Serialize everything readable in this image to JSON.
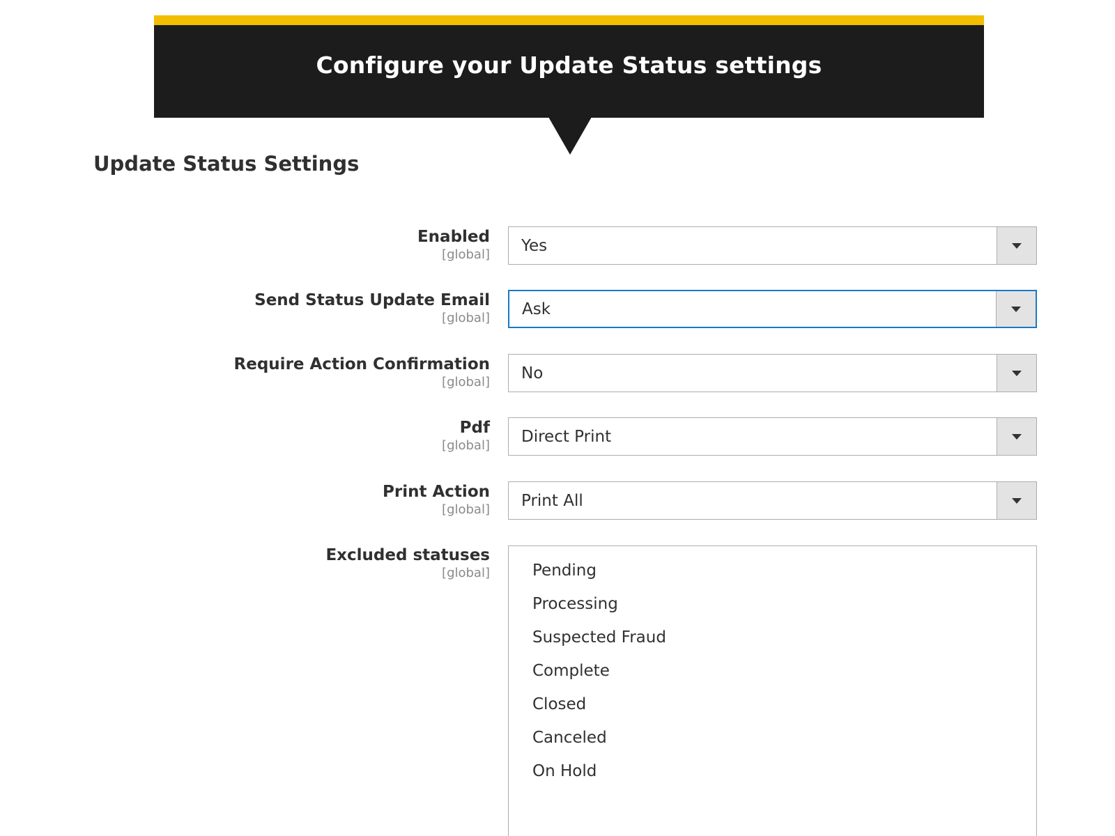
{
  "banner": {
    "title": "Configure your Update Status settings",
    "accent_color": "#f2be00",
    "background_color": "#1c1c1c"
  },
  "section": {
    "title": "Update Status Settings"
  },
  "fields": [
    {
      "label": "Enabled",
      "scope": "[global]",
      "value": "Yes",
      "focused": false
    },
    {
      "label": "Send Status Update Email",
      "scope": "[global]",
      "value": "Ask",
      "focused": true
    },
    {
      "label": "Require Action Confirmation",
      "scope": "[global]",
      "value": "No",
      "focused": false
    },
    {
      "label": "Pdf",
      "scope": "[global]",
      "value": "Direct Print",
      "focused": false
    },
    {
      "label": "Print Action",
      "scope": "[global]",
      "value": "Print All",
      "focused": false
    }
  ],
  "excluded_statuses": {
    "label": "Excluded statuses",
    "scope": "[global]",
    "options": [
      "Pending",
      "Processing",
      "Suspected Fraud",
      "Complete",
      "Closed",
      "Canceled",
      "On Hold"
    ]
  },
  "icons": {
    "dropdown": "chevron-down-icon"
  },
  "colors": {
    "focus_border": "#1979c3",
    "toggle_background": "#e3e3e3"
  }
}
